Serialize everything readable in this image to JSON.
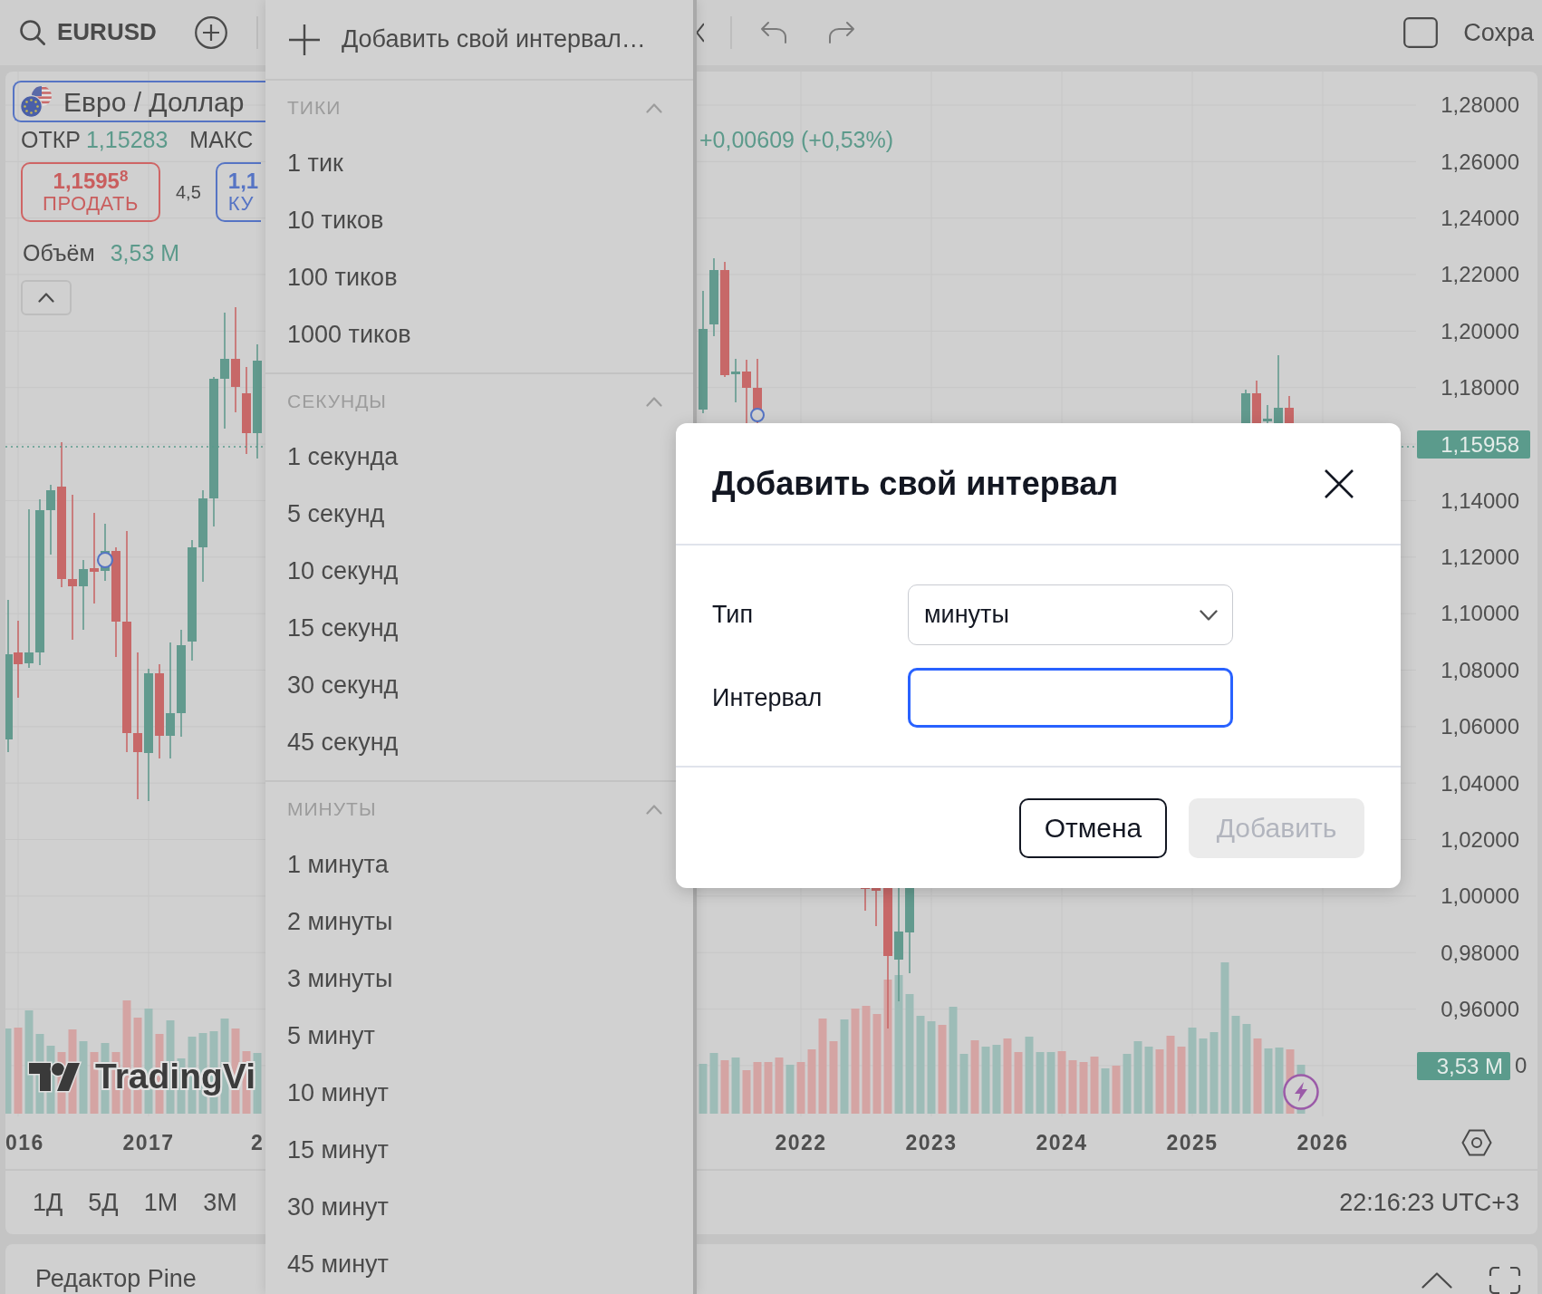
{
  "toolbar": {
    "symbol": "EURUSD",
    "save_label": "Сохра"
  },
  "legend": {
    "symbol_name": "Евро / Доллар",
    "ohlc": [
      {
        "label": "ОТКР",
        "value": "1,15283"
      },
      {
        "label": "МАКС"
      }
    ],
    "change": "+0,00609 (+0,53%)",
    "sell": {
      "price": "1,1595$^{8}$",
      "label": "ПРОДАТЬ"
    },
    "spread": "4,5",
    "buy": {
      "price": "1,1",
      "label": "КУ"
    },
    "volume": {
      "label": "Объём",
      "value": "3,53 M"
    }
  },
  "chart": {
    "logo_text": "TradingVi"
  },
  "price_axis": {
    "labels_above": [
      "1,28000",
      "1,26000",
      "1,24000",
      "1,22000",
      "1,20000",
      "1,18000"
    ],
    "current_price": "1,15958",
    "labels_below": [
      "1,14000",
      "1,12000",
      "1,10000",
      "1,08000",
      "1,06000",
      "1,04000",
      "1,02000",
      "1,00000",
      "0,98000",
      "0,96000"
    ],
    "volume_tag": "3,53 M",
    "last_label_tail": "0"
  },
  "time_axis": {
    "labels": [
      "016",
      "2017",
      "2",
      "2022",
      "2023",
      "2024",
      "2025",
      "2026"
    ]
  },
  "range_bar": {
    "ranges": [
      "1Д",
      "5Д",
      "1М",
      "3М"
    ],
    "clock": "22:16:23 UTC+3"
  },
  "bottom_panel": {
    "title": "Редактор Pine"
  },
  "interval_menu": {
    "add_custom": "Добавить свой интервал…",
    "sections": [
      {
        "title": "ТИКИ",
        "expanded": true,
        "items": [
          "1 тик",
          "10 тиков",
          "100 тиков",
          "1000 тиков"
        ]
      },
      {
        "title": "СЕКУНДЫ",
        "expanded": true,
        "items": [
          "1 секунда",
          "5 секунд",
          "10 секунд",
          "15 секунд",
          "30 секунд",
          "45 секунд"
        ]
      },
      {
        "title": "МИНУТЫ",
        "expanded": true,
        "items": [
          "1 минута",
          "2 минуты",
          "3 минуты",
          "5 минут",
          "10 минут",
          "15 минут",
          "30 минут",
          "45 минут"
        ]
      }
    ]
  },
  "dialog": {
    "title": "Добавить свой интервал",
    "fields": [
      {
        "kind": "select",
        "label": "Тип",
        "value": "минуты"
      },
      {
        "kind": "text",
        "label": "Интервал",
        "focused": true
      }
    ],
    "buttons": [
      {
        "label": "Отмена",
        "kind": "secondary",
        "disabled": false
      },
      {
        "label": "Добавить",
        "kind": "primary",
        "disabled": true
      }
    ]
  }
}
